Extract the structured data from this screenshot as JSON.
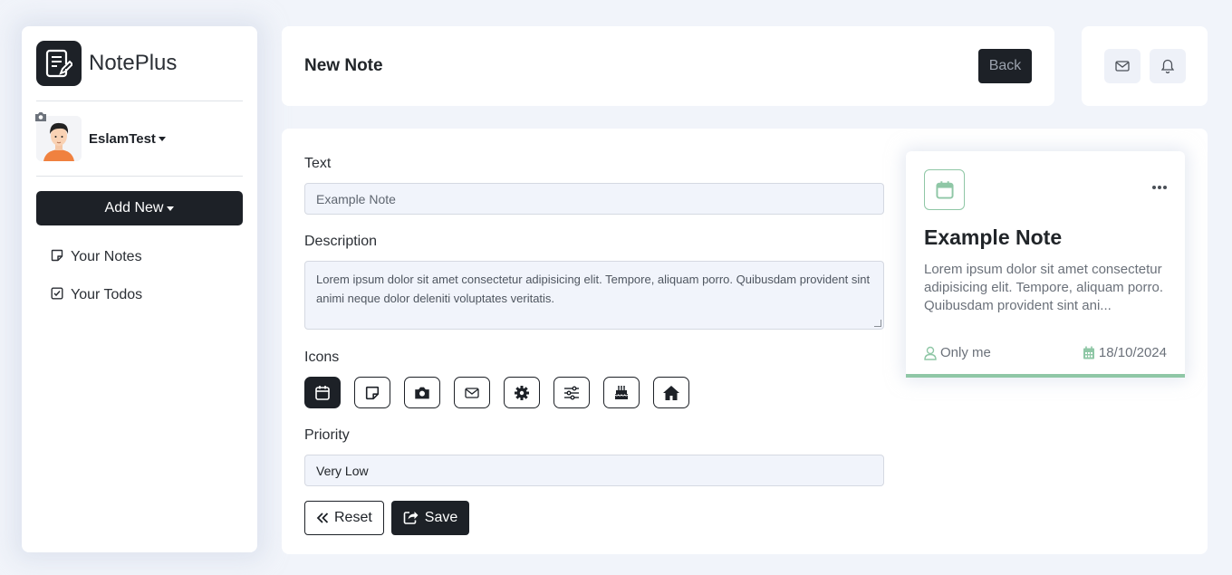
{
  "app": {
    "name": "NotePlus"
  },
  "user": {
    "name": "EslamTest"
  },
  "sidebar": {
    "add_new_label": "Add New",
    "items": [
      {
        "label": "Your Notes",
        "icon": "sticky-note-icon"
      },
      {
        "label": "Your Todos",
        "icon": "checkbox-icon"
      }
    ]
  },
  "header": {
    "title": "New Note",
    "back_label": "Back"
  },
  "form": {
    "text_label": "Text",
    "text_placeholder": "Example Note",
    "description_label": "Description",
    "description_value": "Lorem ipsum dolor sit amet consectetur adipisicing elit. Tempore, aliquam porro. Quibusdam provident sint animi neque dolor deleniti voluptates veritatis.",
    "icons_label": "Icons",
    "icons": [
      "calendar-icon",
      "sticky-note-icon",
      "camera-icon",
      "envelope-icon",
      "gear-icon",
      "sliders-icon",
      "cake-icon",
      "home-icon"
    ],
    "selected_icon": "calendar-icon",
    "priority_label": "Priority",
    "priority_value": "Very Low",
    "reset_label": "Reset",
    "save_label": "Save"
  },
  "preview": {
    "title": "Example Note",
    "description": "Lorem ipsum dolor sit amet consectetur adipisicing elit. Tempore, aliquam porro. Quibusdam provident sint ani...",
    "visibility": "Only me",
    "date": "18/10/2024",
    "accent_color": "#8fc7a6"
  },
  "colors": {
    "primary": "#1d2127",
    "background": "#f1f4fa",
    "accent": "#8fc7a6"
  }
}
